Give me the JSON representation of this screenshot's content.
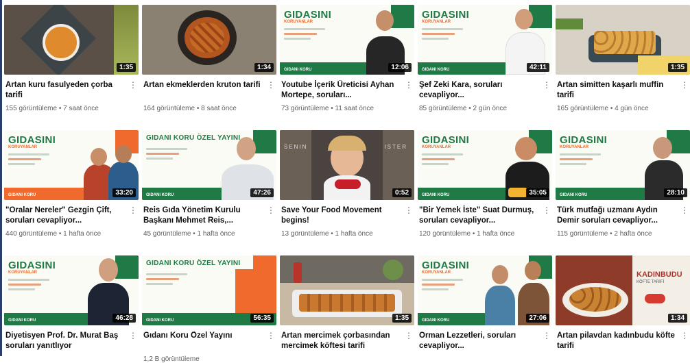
{
  "videos": [
    {
      "title": "Artan kuru fasulyeden çorba tarifi",
      "meta": "155 görüntüleme • 7 saat önce",
      "duration": "1:35"
    },
    {
      "title": "Artan ekmeklerden kruton tarifi",
      "meta": "164 görüntüleme • 8 saat önce",
      "duration": "1:34"
    },
    {
      "title": "Youtube İçerik Üreticisi Ayhan Mortepe, soruları...",
      "meta": "73 görüntüleme • 11 saat önce",
      "duration": "12:06"
    },
    {
      "title": "Şef Zeki Kara, soruları cevapliyor...",
      "meta": "85 görüntüleme • 2 gün önce",
      "duration": "42:11"
    },
    {
      "title": "Artan simitten kaşarlı muffin tarifi",
      "meta": "165 görüntüleme • 4 gün önce",
      "duration": "1:35"
    },
    {
      "title": "\"Oralar Nereler\" Gezgin Çift, soruları cevapliyor...",
      "meta": "440 görüntüleme • 1 hafta önce",
      "duration": "33:20"
    },
    {
      "title": "Reis Gıda Yönetim Kurulu Başkanı Mehmet Reis,...",
      "meta": "45 görüntüleme • 1 hafta önce",
      "duration": "47:26"
    },
    {
      "title": "Save Your Food Movement begins!",
      "meta": "13 görüntüleme • 1 hafta önce",
      "duration": "0:52"
    },
    {
      "title": "\"Bir Yemek İste\" Suat Durmuş, soruları cevapliyor...",
      "meta": "120 görüntüleme • 1 hafta önce",
      "duration": "35:05"
    },
    {
      "title": "Türk mutfağı uzmanı Aydın Demir soruları cevapliyor...",
      "meta": "115 görüntüleme • 2 hafta önce",
      "duration": "28:10"
    },
    {
      "title": "Diyetisyen Prof. Dr. Murat Baş soruları yanıtlıyor",
      "meta": "",
      "duration": "46:28"
    },
    {
      "title": "Gıdanı Koru Özel Yayını",
      "meta": "1,2 B görüntüleme",
      "duration": "56:35"
    },
    {
      "title": "Artan mercimek çorbasından mercimek köftesi tarifi",
      "meta": "",
      "duration": "1:35"
    },
    {
      "title": "Orman Lezzetleri, soruları cevapliyor...",
      "meta": "",
      "duration": "27:06"
    },
    {
      "title": "Artan pilavdan kadınbudu köfte tarifi",
      "meta": "",
      "duration": "1:34"
    }
  ],
  "thumb_text": {
    "gidasini": "GIDASINI",
    "koruyanlar": "KORUYANLAR",
    "gidani_koru": "GIDANI KORU ÖZEL YAYINI",
    "footer": "GIDANI KORU",
    "senin": "SENIN",
    "ister": "ISTER",
    "kadinbudu": "KADINBUDU",
    "kofte": "KÖFTE TARİFİ"
  }
}
